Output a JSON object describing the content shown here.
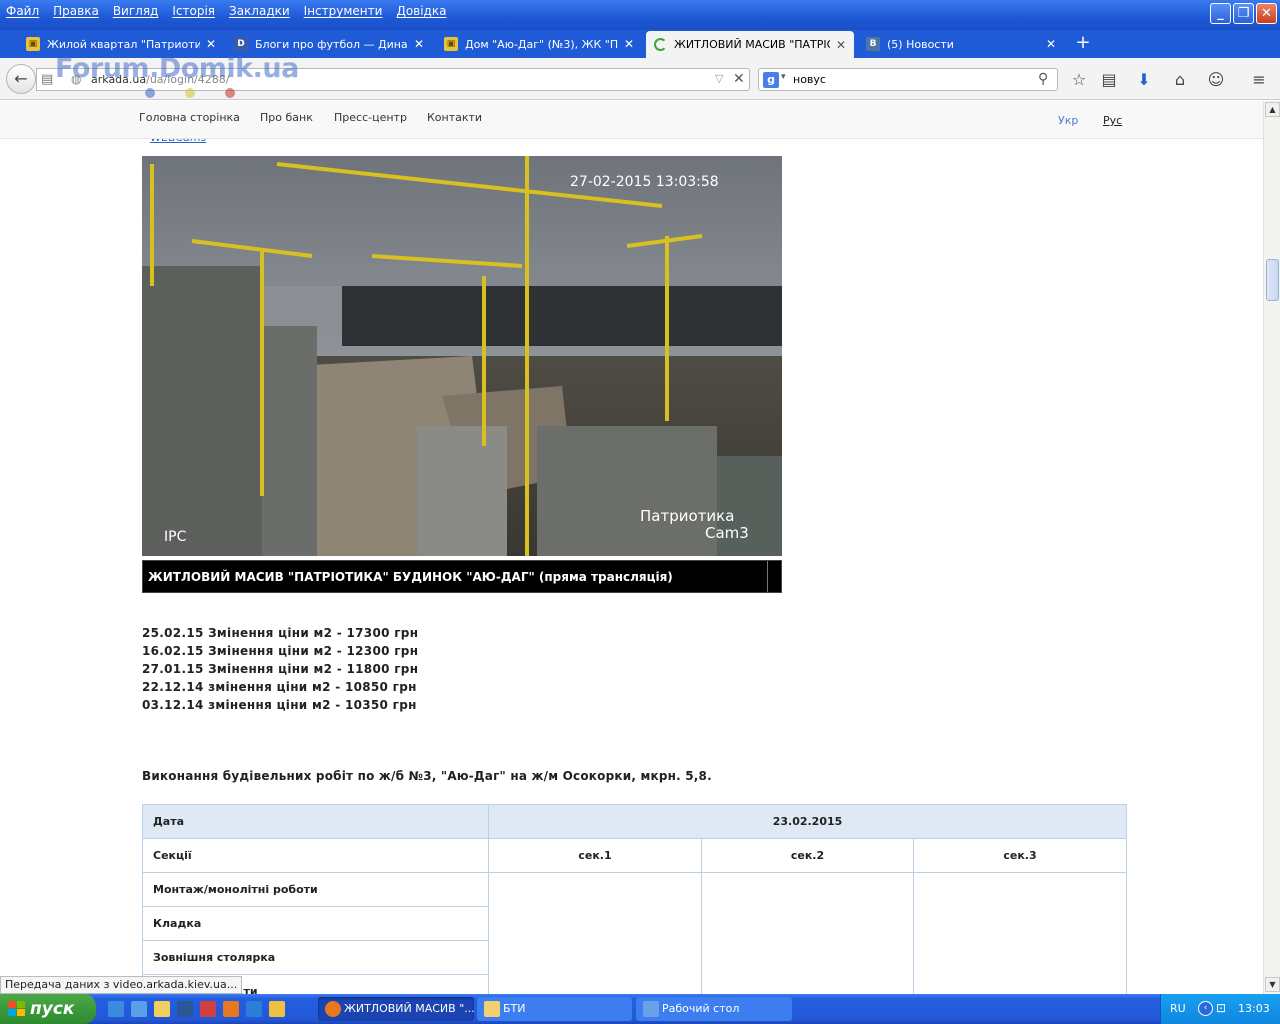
{
  "menu": [
    "Файл",
    "Правка",
    "Вигляд",
    "Історія",
    "Закладки",
    "Інструменти",
    "Довідка"
  ],
  "tabs": [
    {
      "label": "Жилой квартал \"Патриотик...",
      "icon": "building-icon",
      "color": "#e8c23a"
    },
    {
      "label": "Блоги про футбол — Динам...",
      "icon": "blog-icon",
      "color": "#3a5ca8"
    },
    {
      "label": "Дом \"Аю-Даг\" (№3), ЖК \"П...",
      "icon": "building-icon",
      "color": "#e8c23a"
    },
    {
      "label": "ЖИТЛОВИЙ МАСИВ \"ПАТРІО...",
      "icon": "loading-icon",
      "color": "#3ca83c"
    },
    {
      "label": "(5) Новости",
      "icon": "vk-icon",
      "color": "#4a76a8"
    }
  ],
  "nav": {
    "url_host": "arkada.ua",
    "url_path": "/ua/login/4288/",
    "search_value": "новус",
    "watermark": "Forum.Domik.ua"
  },
  "site": {
    "nav_items": [
      "Головна сторінка",
      "Про банк",
      "Пресс-центр",
      "Контакти"
    ],
    "lang_ukr": "Укр",
    "lang_rus": "Рус",
    "webcams_link": "WEBCams"
  },
  "camera": {
    "timestamp": "27-02-2015 13:03:58",
    "brand": "IPC",
    "location": "Патриотика",
    "cam": "Cam3",
    "caption": "ЖИТЛОВИЙ МАСИВ \"ПАТРІОТИКА\" БУДИНОК \"АЮ-ДАГ\" (пряма трансляція)"
  },
  "prices": [
    "25.02.15  Змінення ціни м2 - 17300 грн",
    "16.02.15  Змінення ціни м2 - 12300 грн",
    "27.01.15  Змінення ціни м2 - 11800 грн",
    "22.12.14 змінення ціни м2 - 10850 грн",
    "03.12.14 змінення ціни м2 - 10350 грн"
  ],
  "works": {
    "title": "Виконання будівельних робіт по ж/б №3, \"Аю-Даг\" на ж/м Осокорки, мкрн. 5,8.",
    "date_label": "Дата",
    "date_value": "23.02.2015",
    "sections_label": "Секції",
    "sections": [
      "сек.1",
      "сек.2",
      "сек.3"
    ],
    "rows": [
      "Монтаж/монолітні роботи",
      "Кладка",
      "Зовнішня столярка",
      "...ти"
    ]
  },
  "status_text": "Передача даних з video.arkada.kiev.ua...",
  "taskbar": {
    "start": "пуск",
    "buttons": [
      {
        "label": "ЖИТЛОВИЙ МАСИВ \"...",
        "icon": "firefox-icon"
      },
      {
        "label": "БТИ",
        "icon": "folder-icon"
      },
      {
        "label": "Рабочий стол",
        "icon": "desktop-icon"
      }
    ],
    "lang": "RU",
    "clock": "13:03"
  }
}
